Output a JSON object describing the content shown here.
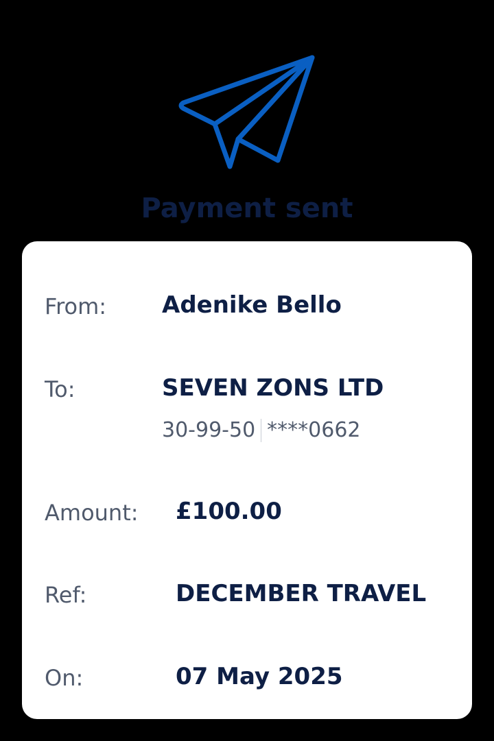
{
  "header": {
    "title": "Payment sent",
    "icon": "paper-plane-icon"
  },
  "details": {
    "from_label": "From:",
    "from_value": "Adenike Bello",
    "to_label": "To:",
    "to_value": "SEVEN ZONS LTD",
    "sort_code": "30-99-50",
    "account_masked": "****0662",
    "amount_label": "Amount:",
    "amount_value": "£100.00",
    "ref_label": "Ref:",
    "ref_value": "DECEMBER TRAVEL",
    "on_label": "On:",
    "on_value": "07 May 2025"
  },
  "colors": {
    "accent": "#0a5fc2",
    "text_dark": "#0e1f45",
    "text_muted": "#505a6c",
    "background": "#000000",
    "card": "#ffffff"
  }
}
